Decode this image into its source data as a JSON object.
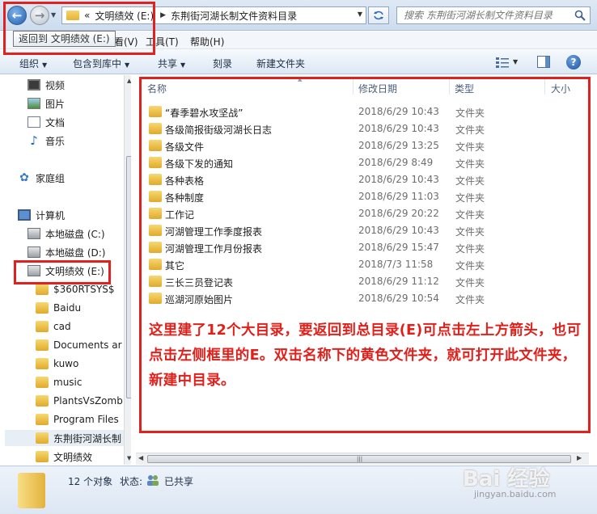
{
  "address": {
    "back_label": "←",
    "forward_label": "→",
    "overflow": "«",
    "breadcrumbs": [
      "文明绩效 (E:)",
      "东荆街河湖长制文件资料目录"
    ],
    "search_placeholder": "搜索 东荆街河湖长制文件资料目录"
  },
  "tooltip": "返回到 文明绩效 (E:)",
  "menu": {
    "view": "看(V)",
    "tools": "工具(T)",
    "help": "帮助(H)"
  },
  "toolbar": {
    "organize": "组织",
    "include_in_library": "包含到库中",
    "share": "共享",
    "burn": "刻录",
    "new_folder": "新建文件夹",
    "help": "?"
  },
  "sidebar": {
    "libraries": [
      "视频",
      "图片",
      "文档",
      "音乐"
    ],
    "homegroup": "家庭组",
    "computer": "计算机",
    "drives": [
      "本地磁盘 (C:)",
      "本地磁盘 (D:)",
      "文明绩效 (E:)"
    ],
    "folders": [
      "$360RTSYS$",
      "Baidu",
      "cad",
      "Documents ar",
      "kuwo",
      "music",
      "PlantsVsZomb",
      "Program Files",
      "东荆街河湖长制",
      "文明绩效"
    ]
  },
  "columns": {
    "name": "名称",
    "date": "修改日期",
    "type": "类型",
    "size": "大小"
  },
  "files": [
    {
      "name": "“春季碧水攻坚战”",
      "date": "2018/6/29 10:43",
      "type": "文件夹"
    },
    {
      "name": "各级简报街级河湖长日志",
      "date": "2018/6/29 10:43",
      "type": "文件夹"
    },
    {
      "name": "各级文件",
      "date": "2018/6/29 13:25",
      "type": "文件夹"
    },
    {
      "name": "各级下发的通知",
      "date": "2018/6/29 8:49",
      "type": "文件夹"
    },
    {
      "name": "各种表格",
      "date": "2018/6/29 10:43",
      "type": "文件夹"
    },
    {
      "name": "各种制度",
      "date": "2018/6/29 11:03",
      "type": "文件夹"
    },
    {
      "name": "工作记",
      "date": "2018/6/29 20:22",
      "type": "文件夹"
    },
    {
      "name": "河湖管理工作季度报表",
      "date": "2018/6/29 10:43",
      "type": "文件夹"
    },
    {
      "name": "河湖管理工作月份报表",
      "date": "2018/6/29 15:47",
      "type": "文件夹"
    },
    {
      "name": "其它",
      "date": "2018/7/3 11:58",
      "type": "文件夹"
    },
    {
      "name": "三长三员登记表",
      "date": "2018/6/29 11:12",
      "type": "文件夹"
    },
    {
      "name": "巡湖河原始图片",
      "date": "2018/6/29 10:54",
      "type": "文件夹"
    }
  ],
  "annotation": "这里建了12个大目录，要返回到总目录(E)可点击左上方箭头，也可点击左侧框里的E。双击名称下的黄色文件夹，就可打开此文件夹，新建中目录。",
  "status": {
    "count": "12 个对象",
    "state_label": "状态:",
    "state_value": "已共享"
  },
  "watermark": {
    "logo": "Bai 经验",
    "url": "jingyan.baidu.com"
  },
  "colors": {
    "annotation_red": "#e1201b",
    "folder_yellow": "#f0c040"
  }
}
